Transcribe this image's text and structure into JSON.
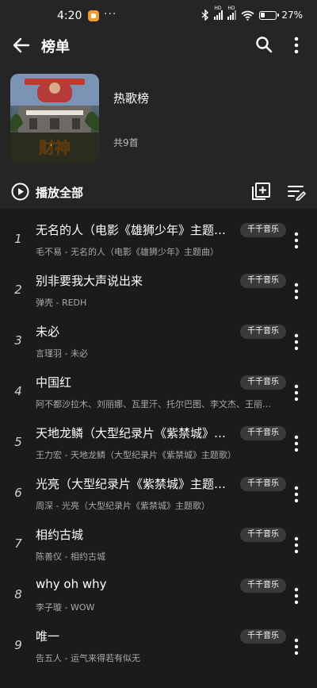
{
  "status_bar": {
    "time": "4:20",
    "battery": "27%",
    "more_dots": "···"
  },
  "header": {
    "title": "榜单"
  },
  "playlist": {
    "name": "热歌榜",
    "count_text": "共9首",
    "cover_text": "财神"
  },
  "actions": {
    "play_all_label": "播放全部"
  },
  "songs": [
    {
      "index": "1",
      "title": "无名的人（电影《雄狮少年》主题曲）",
      "subtitle": "毛不易 - 无名的人（电影《雄狮少年》主题曲）",
      "badge": "千千音乐"
    },
    {
      "index": "2",
      "title": "别非要我大声说出来",
      "subtitle": "弹壳 - REDH",
      "badge": "千千音乐"
    },
    {
      "index": "3",
      "title": "未必",
      "subtitle": "言瑾羽 - 未必",
      "badge": "千千音乐"
    },
    {
      "index": "4",
      "title": "中国红",
      "subtitle": "阿不都沙拉木、刘丽娜、瓦里汗、托尔巴图、李文杰、王丽…",
      "badge": "千千音乐"
    },
    {
      "index": "5",
      "title": "天地龙鳞（大型纪录片《紫禁城》主…",
      "subtitle": "王力宏 - 天地龙鳞（大型纪录片《紫禁城》主题歌）",
      "badge": "千千音乐"
    },
    {
      "index": "6",
      "title": "光亮（大型纪录片《紫禁城》主题歌）",
      "subtitle": "周深 - 光亮（大型纪录片《紫禁城》主题歌）",
      "badge": "千千音乐"
    },
    {
      "index": "7",
      "title": "相约古城",
      "subtitle": "陈善仪 - 相约古城",
      "badge": "千千音乐"
    },
    {
      "index": "8",
      "title": "why oh why",
      "subtitle": "李子璇 - WOW",
      "badge": "千千音乐"
    },
    {
      "index": "9",
      "title": "唯一",
      "subtitle": "告五人 - 运气来得若有似无",
      "badge": "千千音乐"
    }
  ]
}
